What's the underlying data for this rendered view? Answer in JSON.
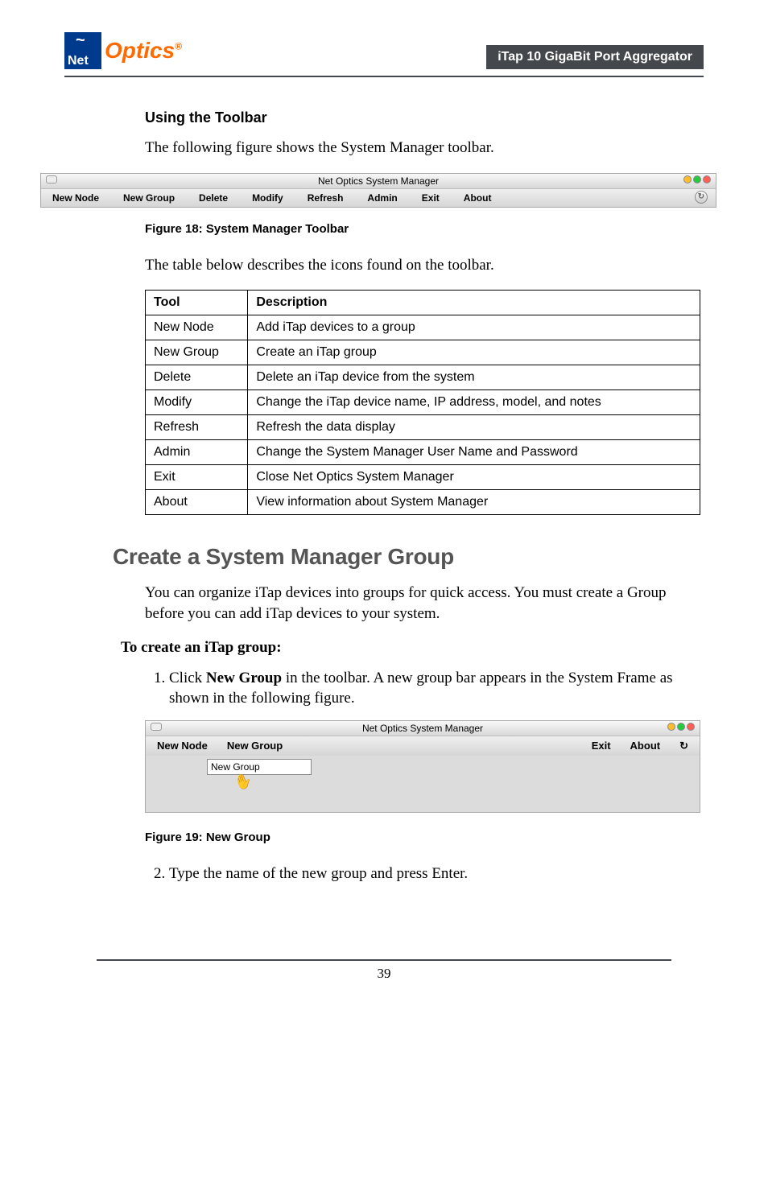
{
  "header": {
    "logo_net": "Net",
    "logo_optics": "Optics",
    "logo_reg": "®",
    "product_title": "iTap 10 GigaBit Port Aggregator"
  },
  "section1": {
    "heading": "Using the Toolbar",
    "intro": "The following figure shows the System Manager toolbar."
  },
  "fig18": {
    "window_title": "Net Optics System Manager",
    "items": [
      "New Node",
      "New Group",
      "Delete",
      "Modify",
      "Refresh",
      "Admin",
      "Exit",
      "About"
    ],
    "caption": "Figure 18: System Manager Toolbar"
  },
  "table_intro": "The table below describes the icons found on the toolbar.",
  "table": {
    "head": [
      "Tool",
      "Description"
    ],
    "rows": [
      [
        "New Node",
        "Add iTap devices to a group"
      ],
      [
        "New Group",
        "Create an iTap group"
      ],
      [
        "Delete",
        "Delete an iTap device from the system"
      ],
      [
        "Modify",
        "Change the iTap device name, IP address, model, and notes"
      ],
      [
        "Refresh",
        "Refresh the data display"
      ],
      [
        "Admin",
        "Change the System Manager User Name and Password"
      ],
      [
        "Exit",
        "Close Net Optics System Manager"
      ],
      [
        "About",
        "View information about System Manager"
      ]
    ]
  },
  "section2": {
    "heading": "Create a System Manager Group",
    "intro": "You can organize iTap devices into groups for quick access. You must create a Group before you can add iTap devices to your system.",
    "procedure_label": "To create an iTap group:",
    "step1_a": "Click ",
    "step1_b": "New Group",
    "step1_c": " in the toolbar. A new group bar appears in the System Frame as shown in the following figure.",
    "step2": "Type the name of the new group and press Enter."
  },
  "fig19": {
    "window_title": "Net Optics System Manager",
    "left_items": [
      "New Node",
      "New Group"
    ],
    "right_items": [
      "Exit",
      "About"
    ],
    "edit_value": "New Group",
    "caption": "Figure 19: New Group"
  },
  "footer": {
    "page": "39"
  }
}
